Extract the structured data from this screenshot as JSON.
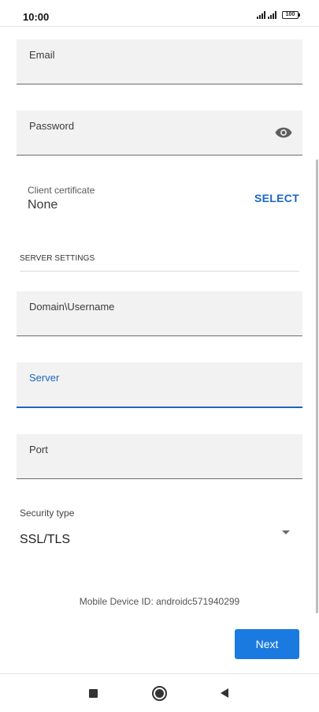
{
  "status_bar": {
    "time": "10:00",
    "battery": "100"
  },
  "form": {
    "email_label": "Email",
    "password_label": "Password",
    "certificate": {
      "label": "Client certificate",
      "value": "None",
      "action_label": "SELECT"
    },
    "server_settings": {
      "header": "SERVER SETTINGS",
      "domain_username_label": "Domain\\Username",
      "server_label": "Server",
      "port_label": "Port"
    },
    "security_type": {
      "label": "Security type",
      "selected": "SSL/TLS"
    },
    "device_id": "Mobile Device ID: androidc571940299",
    "next_label": "Next"
  },
  "colors": {
    "accent": "#1a66c4",
    "button": "#1a7ae0",
    "field_bg": "#f2f2f2"
  }
}
